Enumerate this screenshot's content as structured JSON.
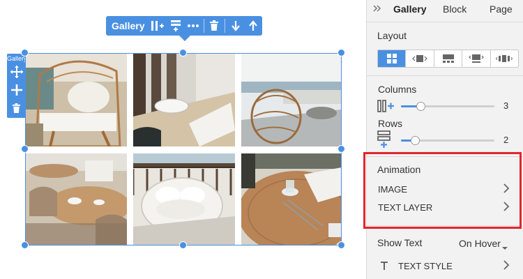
{
  "toolbar": {
    "title": "Gallery",
    "icons": [
      "add-column-icon",
      "add-row-icon",
      "more-icon",
      "trash-icon",
      "move-down-icon",
      "move-up-icon"
    ]
  },
  "side_tools": {
    "label": "Gallery",
    "icons": [
      "move-icon",
      "add-icon",
      "trash-icon"
    ]
  },
  "gallery": {
    "columns": 3,
    "rows": 2
  },
  "panel": {
    "tabs": [
      {
        "label": "Gallery",
        "active": true
      },
      {
        "label": "Block",
        "active": false
      },
      {
        "label": "Page",
        "active": false
      }
    ],
    "layout": {
      "label": "Layout",
      "options": [
        "grid-layout-icon",
        "slider-layout-icon",
        "masonry-layout-icon",
        "carousel-layout-icon",
        "filmstrip-layout-icon"
      ],
      "active_index": 0
    },
    "columns": {
      "label": "Columns",
      "value": "3",
      "fraction": 0.21
    },
    "rows": {
      "label": "Rows",
      "value": "2",
      "fraction": 0.15
    },
    "animation": {
      "label": "Animation",
      "items": [
        "IMAGE",
        "TEXT LAYER"
      ]
    },
    "show_text": {
      "label": "Show Text",
      "value": "On Hover"
    },
    "text_style": {
      "label": "TEXT STYLE"
    }
  },
  "colors": {
    "accent": "#4a90e2",
    "highlight": "#e3252b",
    "panel_bg": "#f2f2f2"
  }
}
